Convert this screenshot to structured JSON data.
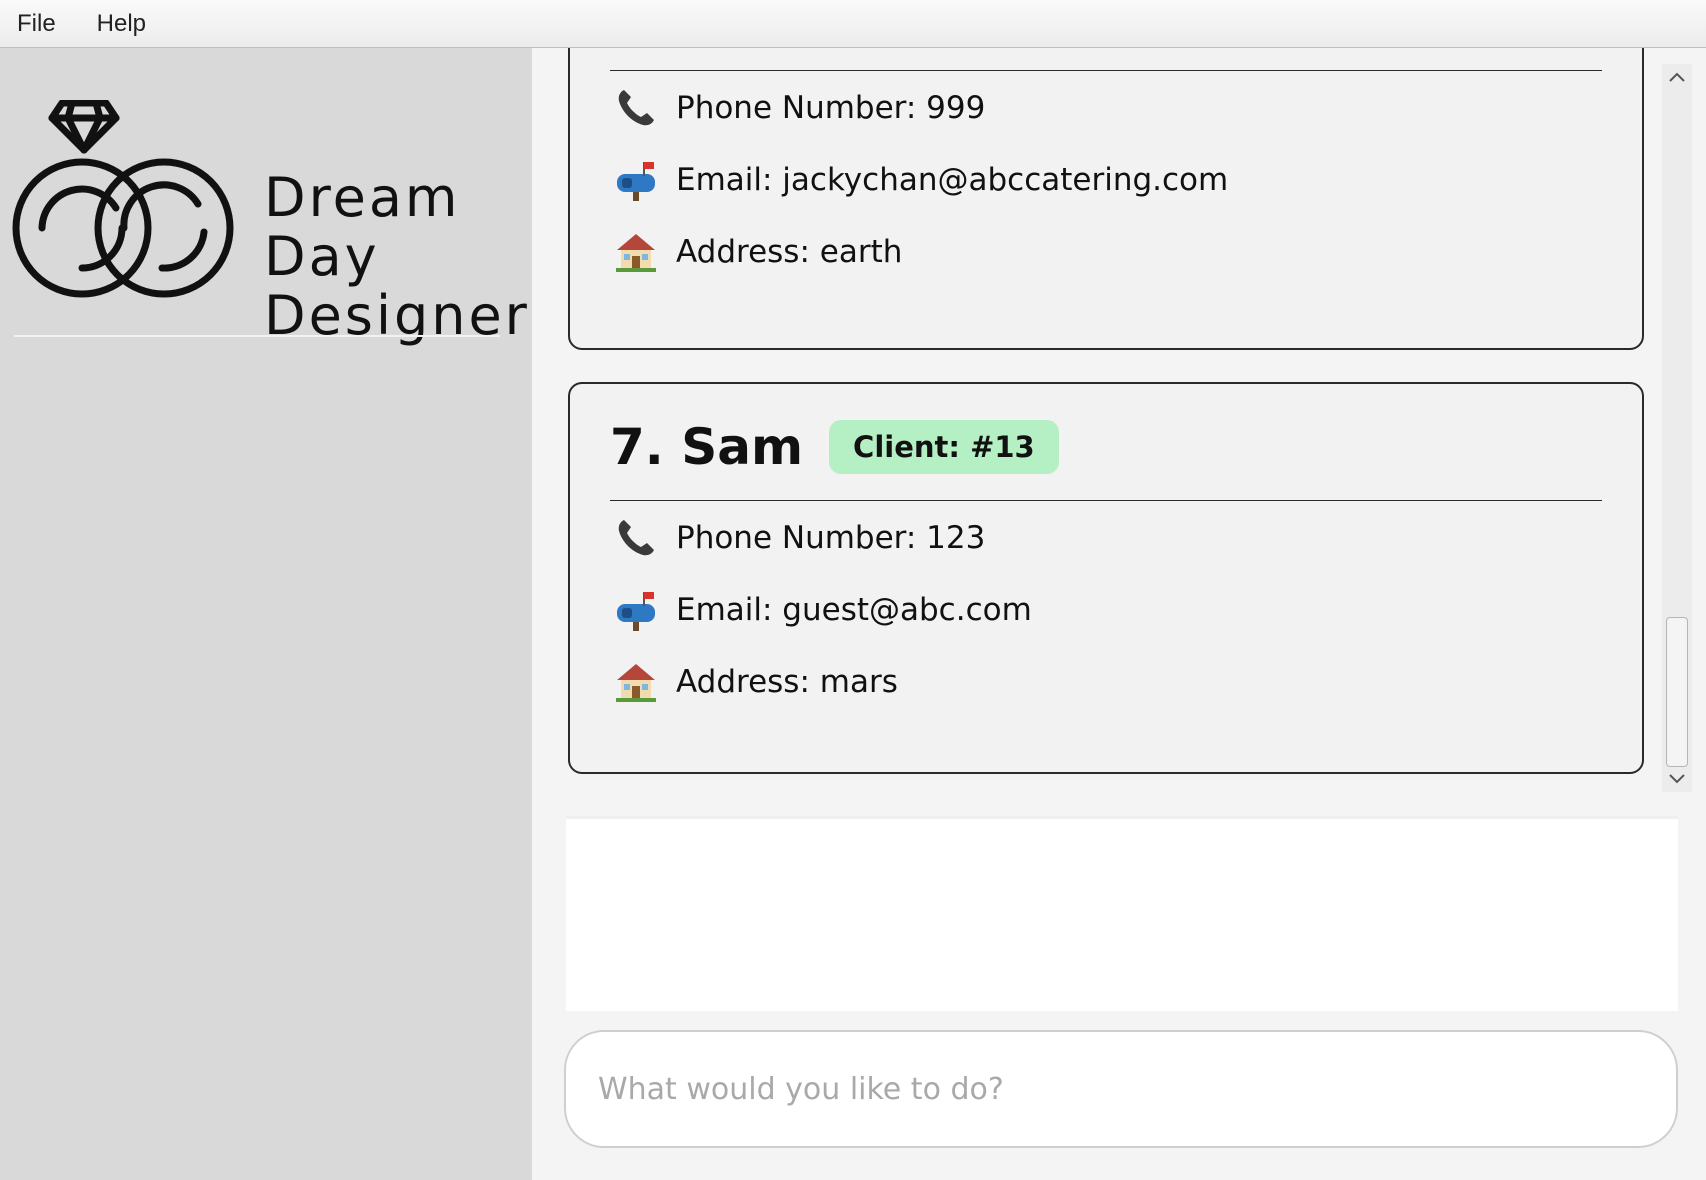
{
  "menu": {
    "file_label": "File",
    "help_label": "Help"
  },
  "logo": {
    "line1": "Dream",
    "line2": "Day",
    "line3": "Designer"
  },
  "contacts": [
    {
      "phone": "Phone Number: 999",
      "email": "Email: jackychan@abccatering.com",
      "address": "Address: earth"
    },
    {
      "name": "7. Sam",
      "tag": "Client: #13",
      "phone": "Phone Number: 123",
      "email": "Email: guest@abc.com",
      "address": "Address: mars"
    }
  ],
  "icons": {
    "phone": "phone-icon",
    "email": "mailbox-icon",
    "address": "house-icon"
  },
  "colors": {
    "tag_background": "#b5efc4",
    "sidebar_background": "#d9d9d9"
  },
  "command": {
    "placeholder": "What would you like to do?",
    "value": ""
  },
  "result": {
    "text": ""
  }
}
